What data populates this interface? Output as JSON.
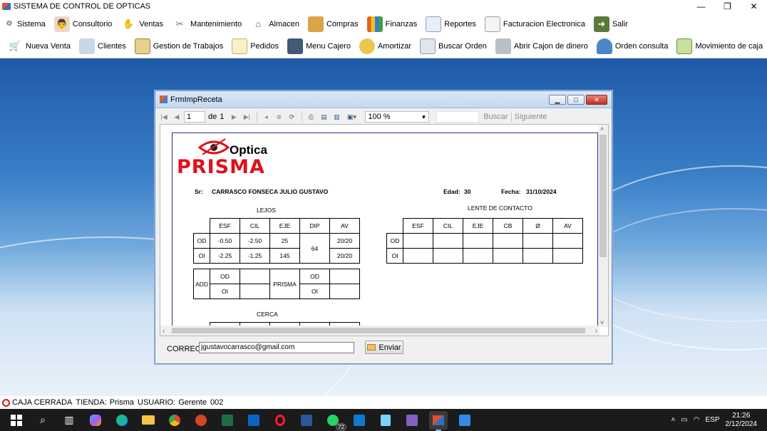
{
  "app": {
    "title": "SISTEMA DE CONTROL DE OPTICAS"
  },
  "window_controls": {
    "minimize": "—",
    "restore": "❐",
    "close": "✕"
  },
  "menu": [
    {
      "label": "Sistema",
      "icon": "gears-icon"
    },
    {
      "label": "Consultorio",
      "icon": "doctor-icon"
    },
    {
      "label": "Ventas",
      "icon": "hand-sale-icon"
    },
    {
      "label": "Mantenimiento",
      "icon": "tools-icon"
    },
    {
      "label": "Almacen",
      "icon": "house-icon"
    },
    {
      "label": "Compras",
      "icon": "boxes-icon"
    },
    {
      "label": "Finanzas",
      "icon": "finance-chart-icon"
    },
    {
      "label": "Reportes",
      "icon": "report-icon"
    },
    {
      "label": "Facturacion Electronica",
      "icon": "invoice-icon"
    },
    {
      "label": "Salir",
      "icon": "exit-door-icon"
    }
  ],
  "toolbar": [
    {
      "label": "Nueva Venta",
      "icon": "cart-icon"
    },
    {
      "label": "Clientes",
      "icon": "users-icon"
    },
    {
      "label": "Gestion de Trabajos",
      "icon": "clipboard-icon"
    },
    {
      "label": "Pedidos",
      "icon": "notepad-icon"
    },
    {
      "label": "Menu Cajero",
      "icon": "cashier-icon"
    },
    {
      "label": "Amortizar",
      "icon": "coins-add-icon"
    },
    {
      "label": "Buscar Orden",
      "icon": "search-document-icon"
    },
    {
      "label": "Abrir Cajon de dinero",
      "icon": "cash-register-icon"
    },
    {
      "label": "Orden consulta",
      "icon": "person-icon"
    },
    {
      "label": "Movimiento de caja",
      "icon": "money-icon"
    }
  ],
  "child_window": {
    "title": "FrmImpReceta",
    "page_current": "1",
    "page_of": "de",
    "page_total": "1",
    "zoom": "100 %",
    "find_label": "Buscar",
    "next_label": "Siguiente",
    "correo_label": "CORREO",
    "email": "jgustavocarrasco@gmail.com",
    "send_label": "Enviar"
  },
  "report": {
    "logo_top": "Optica",
    "logo_bottom": "PRISMA",
    "sr_label": "Sr:",
    "patient": "CARRASCO FONSECA JULIO GUSTAVO",
    "age_label": "Edad:",
    "age": "30",
    "date_label": "Fecha:",
    "date": "31/10/2024",
    "lejos_title": "LEJOS",
    "contact_title": "LENTE DE CONTACTO",
    "cerca_title": "CERCA",
    "lejos_headers": [
      "ESF",
      "CIL",
      "EJE",
      "DIP",
      "AV"
    ],
    "lejos_rows": [
      {
        "eye": "OD",
        "esf": "-0.50",
        "cil": "-2.50",
        "eje": "25",
        "av": "20/20"
      },
      {
        "eye": "OI",
        "esf": "-2.25",
        "cil": "-1.25",
        "eje": "145",
        "av": "20/20"
      }
    ],
    "dip": "64",
    "add_label": "ADD",
    "prisma_label": "PRISMA",
    "od": "OD",
    "oi": "OI",
    "contact_headers": [
      "ESF",
      "CIL",
      "EJE",
      "CB",
      "Ø",
      "AV"
    ]
  },
  "status": {
    "caja": "CAJA CERRADA",
    "tienda_label": "TIENDA:",
    "tienda": "Prisma",
    "usuario_label": "USUARIO:",
    "usuario": "Gerente",
    "code": "002"
  },
  "taskbar": {
    "whatsapp_badge": "72",
    "language": "ESP",
    "time": "21:26",
    "date": "2/12/2024"
  }
}
